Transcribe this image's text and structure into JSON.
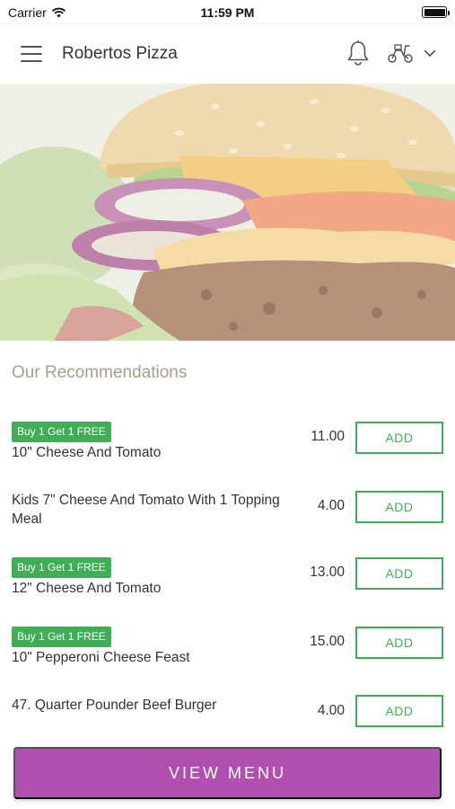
{
  "status_bar": {
    "carrier": "Carrier",
    "time": "11:59 PM"
  },
  "header": {
    "title": "Robertos Pizza"
  },
  "icons": {
    "menu": "hamburger-icon",
    "notifications": "bell-icon",
    "delivery": "scooter-icon",
    "dropdown": "chevron-down-icon",
    "wifi": "wifi-icon",
    "battery": "battery-icon"
  },
  "hero": {
    "image": "burger-image"
  },
  "recommendations": {
    "title": "Our Recommendations",
    "items": [
      {
        "badge": "Buy 1 Get 1 FREE",
        "name": "10\" Cheese And Tomato",
        "price": "11.00",
        "action": "ADD"
      },
      {
        "badge": "",
        "name": "Kids 7\" Cheese And Tomato With 1 Topping Meal",
        "price": "4.00",
        "action": "ADD"
      },
      {
        "badge": "Buy 1 Get 1 FREE",
        "name": "12\" Cheese And Tomato",
        "price": "13.00",
        "action": "ADD"
      },
      {
        "badge": "Buy 1 Get 1 FREE",
        "name": "10\" Pepperoni Cheese Feast",
        "price": "15.00",
        "action": "ADD"
      },
      {
        "badge": "",
        "name": "47. Quarter Pounder Beef Burger",
        "price": "4.00",
        "action": "ADD"
      }
    ]
  },
  "footer": {
    "view_menu_label": "VIEW MENU"
  },
  "colors": {
    "accent_green": "#3fae56",
    "primary_purple": "#b04fae",
    "section_title": "#a99d84"
  }
}
